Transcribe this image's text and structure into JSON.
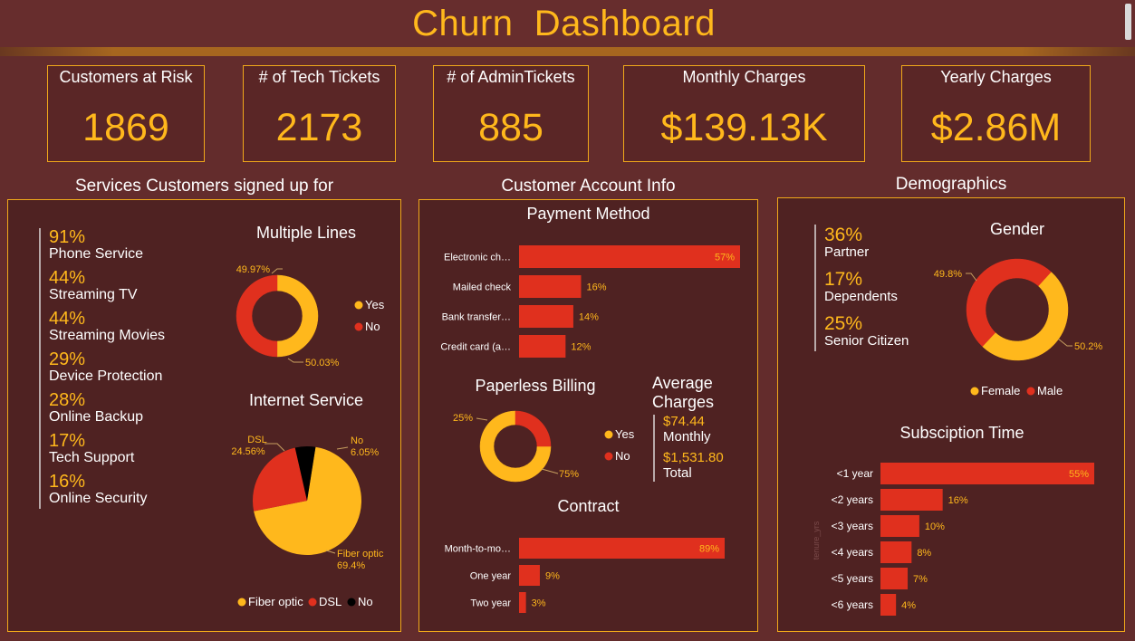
{
  "title": "Churn  Dashboard",
  "kpis": [
    {
      "label": "Customers at Risk",
      "value": "1869"
    },
    {
      "label": "# of Tech Tickets",
      "value": "2173"
    },
    {
      "label": "# of AdminTickets",
      "value": "885"
    },
    {
      "label": "Monthly Charges",
      "value": "$139.13K"
    },
    {
      "label": "Yearly Charges",
      "value": "$2.86M"
    }
  ],
  "sections": {
    "services": "Services Customers signed up for",
    "account": "Customer Account Info",
    "demographics": "Demographics"
  },
  "services": [
    {
      "pct": "91%",
      "label": "Phone Service"
    },
    {
      "pct": "44%",
      "label": "Streaming TV"
    },
    {
      "pct": "44%",
      "label": "Streaming Movies"
    },
    {
      "pct": "29%",
      "label": "Device Protection"
    },
    {
      "pct": "28%",
      "label": "Online Backup"
    },
    {
      "pct": "17%",
      "label": "Tech Support"
    },
    {
      "pct": "16%",
      "label": "Online Security"
    }
  ],
  "demographics_stats": [
    {
      "pct": "36%",
      "label": "Partner"
    },
    {
      "pct": "17%",
      "label": "Dependents"
    },
    {
      "pct": "25%",
      "label": "Senior Citizen"
    }
  ],
  "average_charges": {
    "title": "Average Charges",
    "monthly_value": "$74.44",
    "monthly_label": "Monthly",
    "total_value": "$1,531.80",
    "total_label": "Total"
  },
  "colors": {
    "gold": "#ffb81c",
    "red": "#e0301e",
    "black": "#000000"
  },
  "chart_data": [
    {
      "id": "multiple-lines",
      "type": "donut",
      "title": "Multiple Lines",
      "categories": [
        "Yes",
        "No"
      ],
      "values": [
        50.03,
        49.97
      ],
      "data_labels": [
        "50.03%",
        "49.97%"
      ],
      "legend_placement": "right"
    },
    {
      "id": "internet-service",
      "type": "pie",
      "title": "Internet Service",
      "categories": [
        "Fiber optic",
        "DSL",
        "No"
      ],
      "values": [
        69.4,
        24.56,
        6.05
      ],
      "data_labels": [
        "Fiber optic\n69.4%",
        "DSL\n24.56%",
        "No\n6.05%"
      ],
      "legend_placement": "bottom"
    },
    {
      "id": "payment-method",
      "type": "bar",
      "title": "Payment Method",
      "categories": [
        "Electronic ch…",
        "Mailed check",
        "Bank transfer…",
        "Credit card (a…"
      ],
      "values": [
        57,
        16,
        14,
        12
      ],
      "data_labels": [
        "57%",
        "16%",
        "14%",
        "12%"
      ]
    },
    {
      "id": "paperless-billing",
      "type": "donut",
      "title": "Paperless Billing",
      "categories": [
        "Yes",
        "No"
      ],
      "values": [
        75,
        25
      ],
      "data_labels": [
        "75%",
        "25%"
      ],
      "legend_placement": "right"
    },
    {
      "id": "contract",
      "type": "bar",
      "title": "Contract",
      "categories": [
        "Month-to-mo…",
        "One year",
        "Two year"
      ],
      "values": [
        89,
        9,
        3
      ],
      "data_labels": [
        "89%",
        "9%",
        "3%"
      ]
    },
    {
      "id": "gender",
      "type": "donut",
      "title": "Gender",
      "categories": [
        "Female",
        "Male"
      ],
      "values": [
        50.2,
        49.8
      ],
      "data_labels": [
        "50.2%",
        "49.8%"
      ],
      "legend_placement": "bottom"
    },
    {
      "id": "subscription-time",
      "type": "bar",
      "title": "Subsciption Time",
      "ylabel": "tenure_yrs",
      "categories": [
        "<1 year",
        "<2 years",
        "<3 years",
        "<4 years",
        "<5 years",
        "<6 years"
      ],
      "values": [
        55,
        16,
        10,
        8,
        7,
        4
      ],
      "data_labels": [
        "55%",
        "16%",
        "10%",
        "8%",
        "7%",
        "4%"
      ]
    }
  ]
}
